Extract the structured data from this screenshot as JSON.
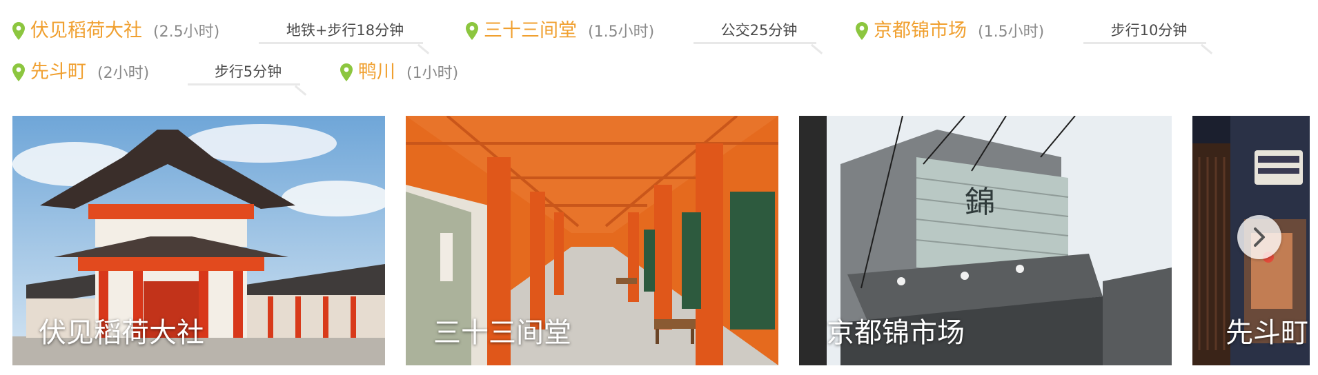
{
  "route": {
    "stops": [
      {
        "name": "伏见稻荷大社",
        "duration": "(2.5小时)"
      },
      {
        "name": "三十三间堂",
        "duration": "(1.5小时)"
      },
      {
        "name": "京都锦市场",
        "duration": "(1.5小时)"
      },
      {
        "name": "先斗町",
        "duration": "(2小时)"
      },
      {
        "name": "鸭川",
        "duration": "(1小时)"
      }
    ],
    "transits": [
      {
        "label": "地铁+步行18分钟"
      },
      {
        "label": "公交25分钟"
      },
      {
        "label": "步行10分钟"
      },
      {
        "label": "步行5分钟"
      }
    ]
  },
  "cards": [
    {
      "title": "伏见稻荷大社"
    },
    {
      "title": "三十三间堂"
    },
    {
      "title": "京都锦市场"
    },
    {
      "title": "先斗町"
    }
  ],
  "icons": {
    "stop": "location-pin-icon",
    "next": "chevron-right-icon"
  },
  "colors": {
    "accent": "#f0a030",
    "pin": "#8cc63f",
    "muted": "#8a8a8a"
  }
}
